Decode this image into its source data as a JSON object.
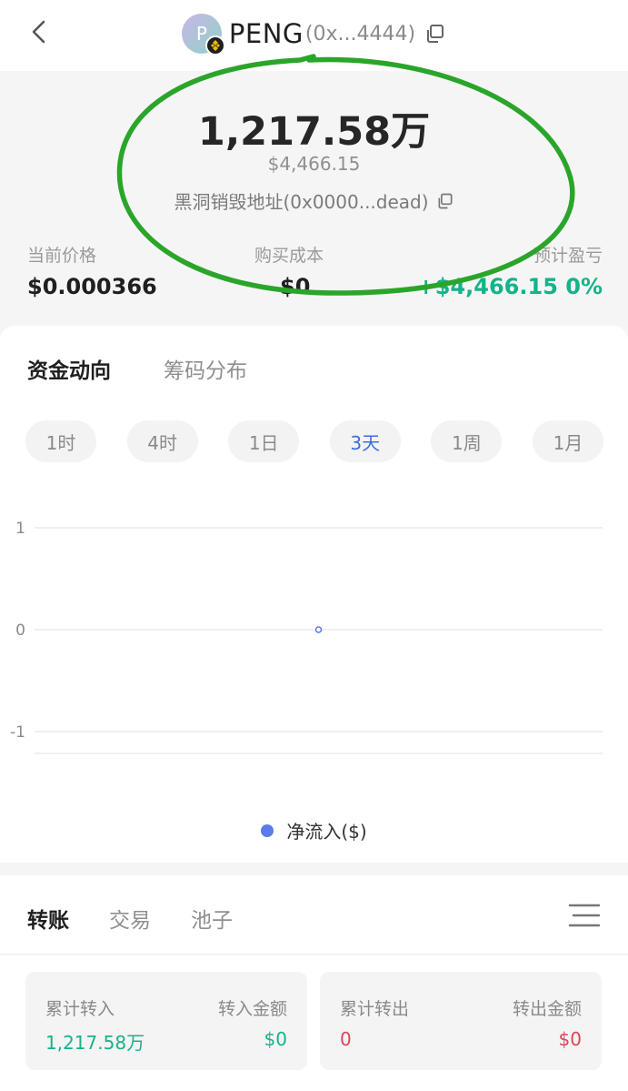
{
  "header": {
    "avatar_letter": "P",
    "symbol": "PENG",
    "address_short": "(0x...4444)"
  },
  "hero": {
    "amount": "1,217.58万",
    "usd_value": "$4,466.15",
    "holder_label": "黑洞销毁地址(0x0000...dead)"
  },
  "stats": {
    "current_price_label": "当前价格",
    "current_price_value": "$0.000366",
    "cost_label": "购买成本",
    "cost_value": "$0",
    "pnl_label": "预计盈亏",
    "pnl_value": "+$4,466.15 0%"
  },
  "tabs": {
    "fund_flow": "资金动向",
    "chip_distribution": "筹码分布"
  },
  "periods": [
    "1时",
    "4时",
    "1日",
    "3天",
    "1周",
    "1月"
  ],
  "active_period": "3天",
  "chart_data": {
    "type": "line",
    "series": [
      {
        "name": "净流入($)",
        "values": [
          0
        ]
      }
    ],
    "ylim": [
      -1,
      1
    ],
    "yticks": [
      "1",
      "0",
      "-1"
    ],
    "legend": "bottom",
    "color": "#5b7be8"
  },
  "bottom_tabs": {
    "transfer": "转账",
    "trade": "交易",
    "pool": "池子"
  },
  "transfers": {
    "in_label": "累计转入",
    "in_amount_label": "转入金额",
    "in_count": "1,217.58万",
    "in_amount": "$0",
    "out_label": "累计转出",
    "out_amount_label": "转出金额",
    "out_count": "0",
    "out_amount": "$0"
  },
  "colors": {
    "positive": "#14b38a",
    "negative": "#e0435a",
    "accent": "#3b6de0",
    "annotation": "#2aa52a"
  }
}
